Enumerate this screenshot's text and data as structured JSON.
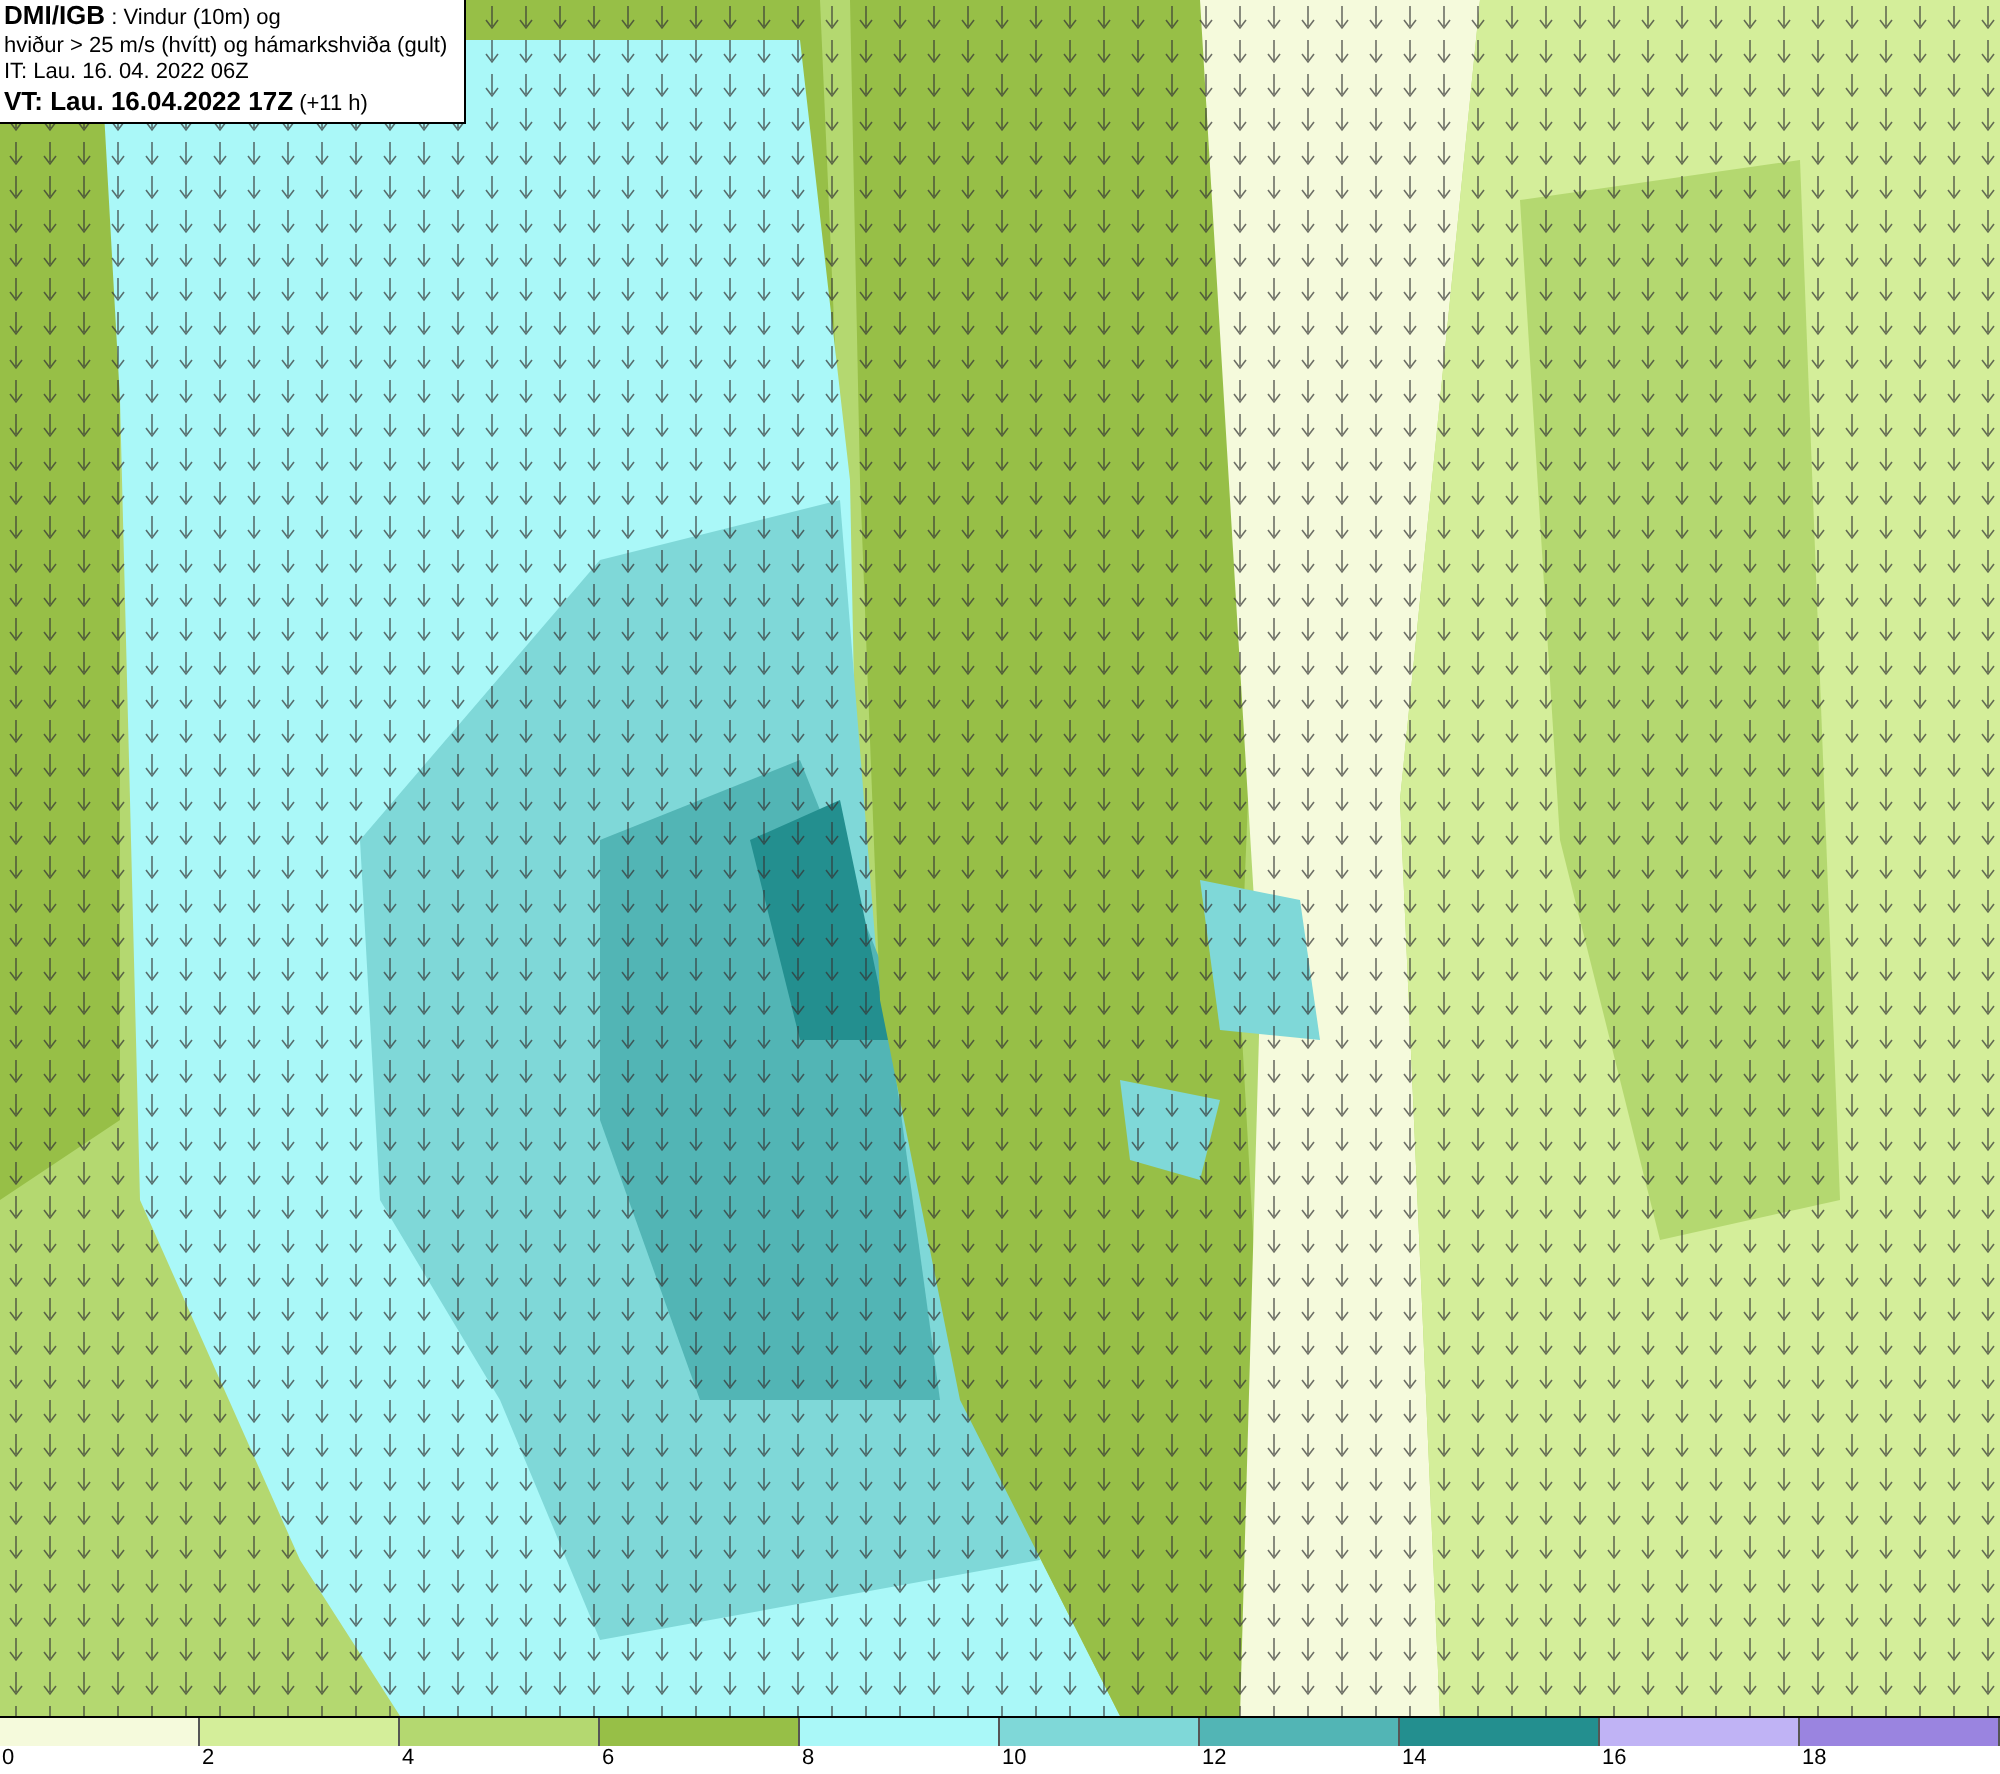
{
  "header": {
    "lines": [
      "**DMI/IGB** : Vindur (10m) og",
      "hviður > 25 m/s (hvítt) og hámarkshviða (gult)",
      "IT: Lau. 16. 04. 2022 06Z",
      "**VT: Lau. 16.04.2022 17Z** (+11 h)"
    ]
  },
  "legend": {
    "bins": [
      {
        "label": "0",
        "color": "#f5fadc"
      },
      {
        "label": "2",
        "color": "#d4ee9a"
      },
      {
        "label": "4",
        "color": "#b4d870"
      },
      {
        "label": "6",
        "color": "#97bf47"
      },
      {
        "label": "8",
        "color": "#aaf8f8"
      },
      {
        "label": "10",
        "color": "#7fd8d8"
      },
      {
        "label": "12",
        "color": "#52b5b5"
      },
      {
        "label": "14",
        "color": "#238f8f"
      },
      {
        "label": "16",
        "color": "#c0b3f5"
      },
      {
        "label": "18",
        "color": "#9a84e0"
      }
    ]
  }
}
